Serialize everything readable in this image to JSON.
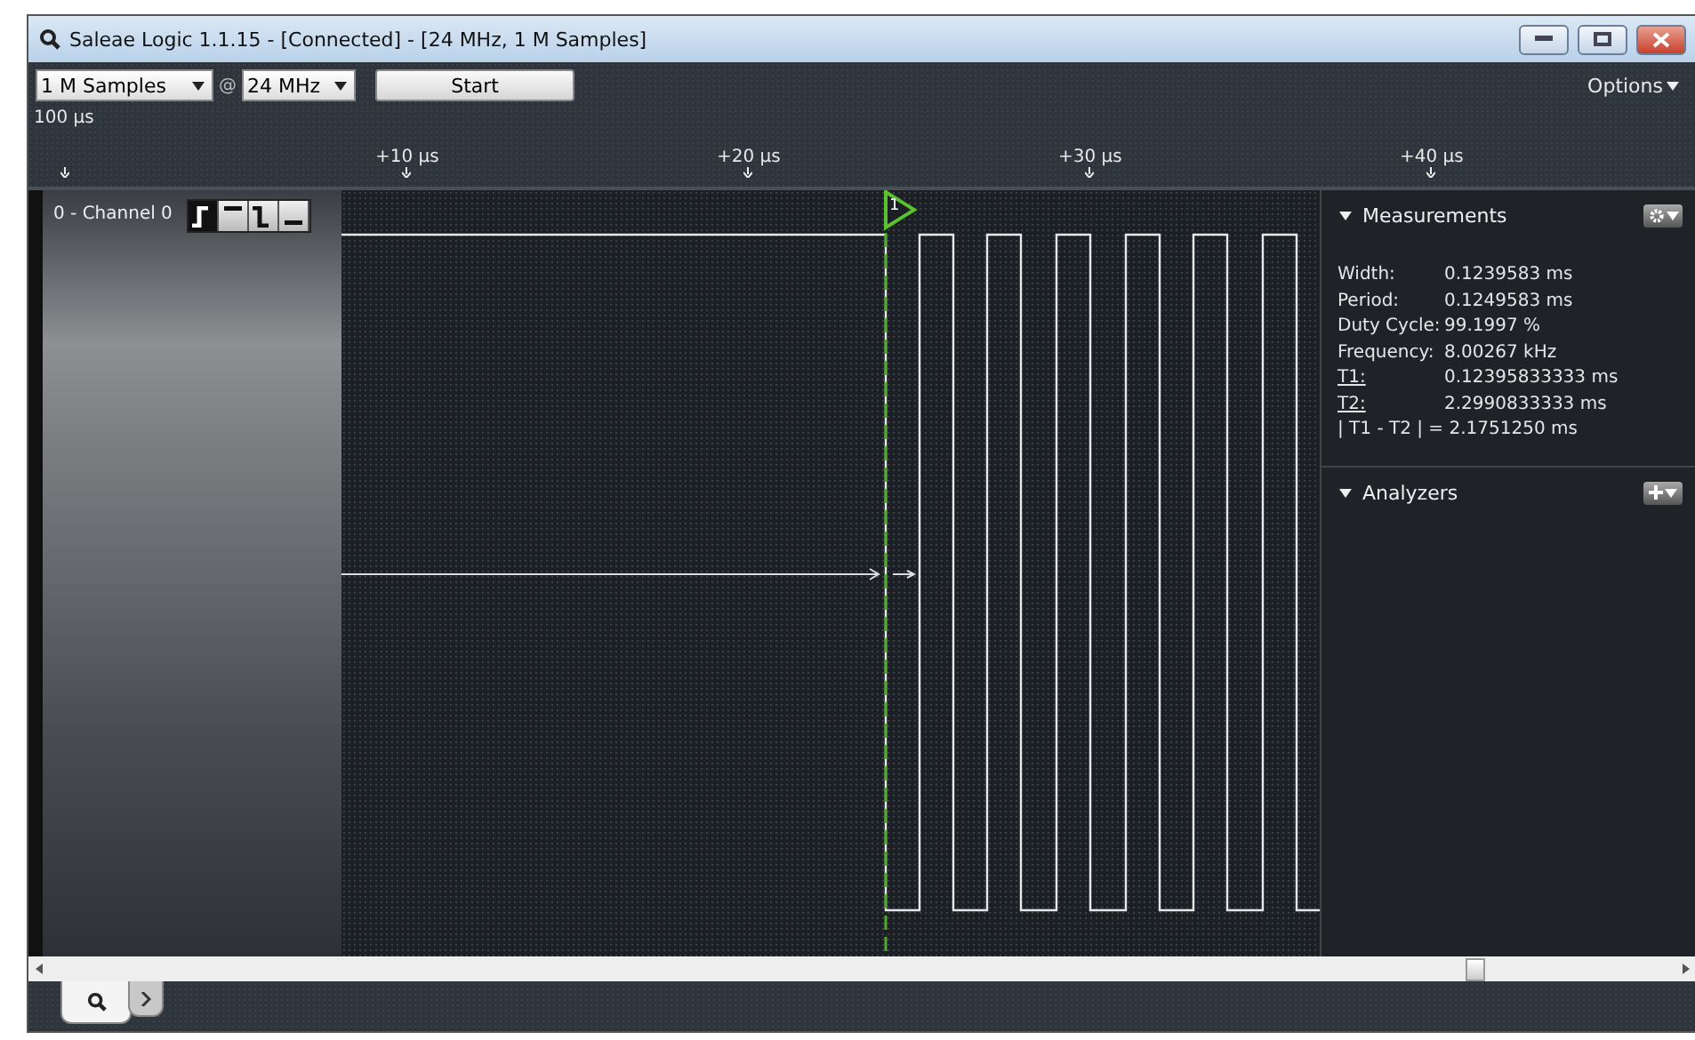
{
  "window": {
    "title": "Saleae Logic 1.1.15 - [Connected] - [24 MHz, 1 M Samples]"
  },
  "toolbar": {
    "samples": "1 M Samples",
    "at": "@",
    "rate": "24 MHz",
    "start": "Start",
    "options": "Options"
  },
  "ruler": {
    "span": "100 µs",
    "ticks": [
      "+10 µs",
      "+20 µs",
      "+30 µs",
      "+40 µs"
    ]
  },
  "channel": {
    "name": "0 - Channel 0",
    "triggers": [
      {
        "kind": "rising",
        "selected": true
      },
      {
        "kind": "high",
        "selected": false
      },
      {
        "kind": "falling",
        "selected": false
      },
      {
        "kind": "low",
        "selected": false
      }
    ]
  },
  "marker": {
    "label": "1"
  },
  "measurements": {
    "title": "Measurements",
    "expanded": true,
    "rows": [
      {
        "kind": "plain",
        "label": "Width:",
        "value": "0.1239583 ms"
      },
      {
        "kind": "plain",
        "label": "Period:",
        "value": "0.1249583 ms"
      },
      {
        "kind": "plain",
        "label": "Duty Cycle:",
        "value": "99.1997 %"
      },
      {
        "kind": "plain",
        "label": "Frequency:",
        "value": "8.00267 kHz"
      },
      {
        "kind": "marker",
        "label": "T1:",
        "value": "0.12395833333 ms"
      },
      {
        "kind": "marker",
        "label": "T2:",
        "value": "2.2990833333 ms"
      },
      {
        "kind": "full",
        "label": "| T1 - T2 | = 2.1751250 ms"
      }
    ]
  },
  "analyzers": {
    "title": "Analyzers",
    "expanded": true
  },
  "bottom_tabs": [
    {
      "kind": "search",
      "selected": true
    },
    {
      "kind": "console",
      "selected": false
    }
  ]
}
